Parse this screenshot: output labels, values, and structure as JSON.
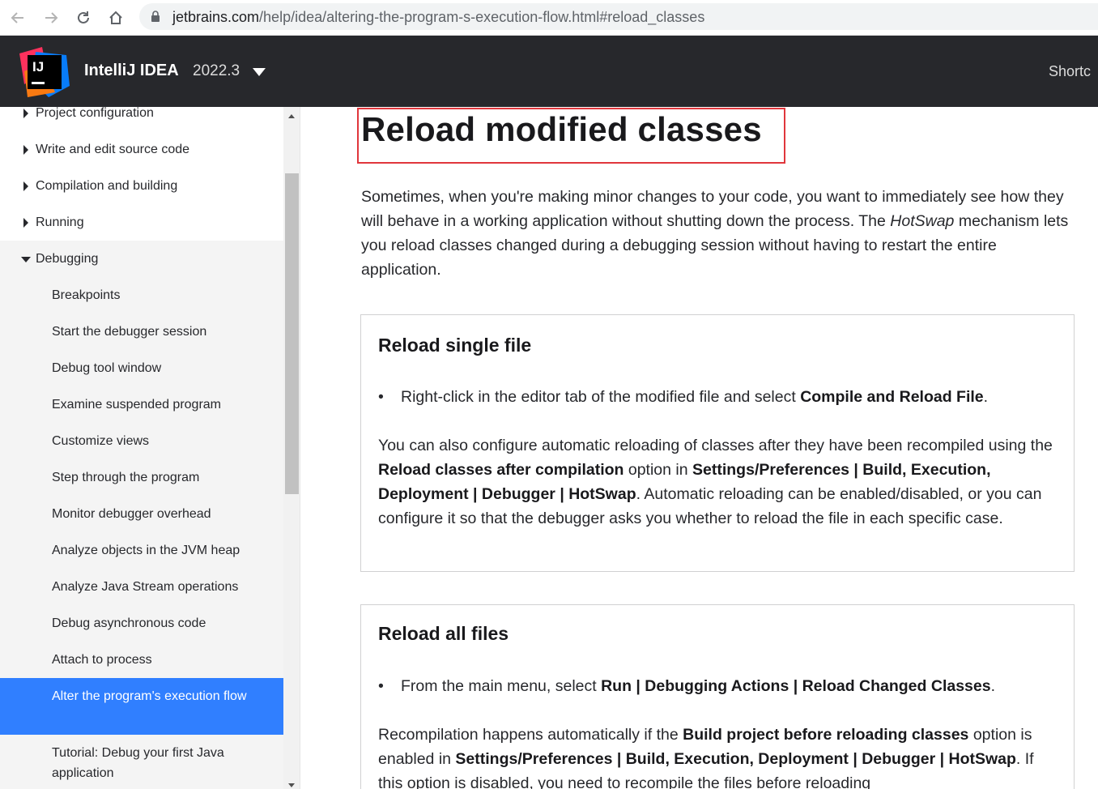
{
  "browser": {
    "url_host": "jetbrains.com",
    "url_path": "/help/idea/altering-the-program-s-execution-flow.html#reload_classes"
  },
  "header": {
    "product_name": "IntelliJ IDEA",
    "version": "2022.3",
    "logo_text": "IJ",
    "shortcuts_label": "Shortc"
  },
  "sidebar": {
    "items": [
      {
        "label": "Project configuration"
      },
      {
        "label": "Write and edit source code"
      },
      {
        "label": "Compilation and building"
      },
      {
        "label": "Running"
      },
      {
        "label": "Debugging"
      },
      {
        "label": "Breakpoints"
      },
      {
        "label": "Start the debugger session"
      },
      {
        "label": "Debug tool window"
      },
      {
        "label": "Examine suspended program"
      },
      {
        "label": "Customize views"
      },
      {
        "label": "Step through the program"
      },
      {
        "label": "Monitor debugger overhead"
      },
      {
        "label": "Analyze objects in the JVM heap"
      },
      {
        "label": "Analyze Java Stream operations"
      },
      {
        "label": "Debug asynchronous code"
      },
      {
        "label": "Attach to process"
      },
      {
        "label": "Alter the program's execution flow"
      },
      {
        "label": "Tutorial: Debug your first Java application"
      }
    ]
  },
  "article": {
    "title": "Reload modified classes",
    "intro": {
      "t1": "Sometimes, when you're making minor changes to your code, you want to immediately see how they will behave in a working application without shutting down the process. The ",
      "em": "HotSwap",
      "t2": " mechanism lets you reload classes changed during a debugging session without having to restart the entire application."
    },
    "section1": {
      "title": "Reload single file",
      "bullet_text": "Right-click in the editor tab of the modified file and select ",
      "bullet_bold": "Compile and Reload File",
      "bullet_end": ".",
      "p_t1": "You can also configure automatic reloading of classes after they have been recompiled using the ",
      "p_b1": "Reload classes after compilation",
      "p_t2": " option in ",
      "p_b2": "Settings/Preferences | Build, Execution, Deployment | Debugger | HotSwap",
      "p_t3": ". Automatic reloading can be enabled/disabled, or you can configure it so that the debugger asks you whether to reload the file in each specific case."
    },
    "section2": {
      "title": "Reload all files",
      "bullet_text": "From the main menu, select ",
      "bullet_bold": "Run | Debugging Actions | Reload Changed Classes",
      "bullet_end": ".",
      "p_t1": "Recompilation happens automatically if the ",
      "p_b1": "Build project before reloading classes",
      "p_t2": " option is enabled in ",
      "p_b2": "Settings/Preferences | Build, Execution, Deployment | Debugger | HotSwap",
      "p_t3": ". If this option is disabled, you need to recompile the files before reloading"
    }
  }
}
